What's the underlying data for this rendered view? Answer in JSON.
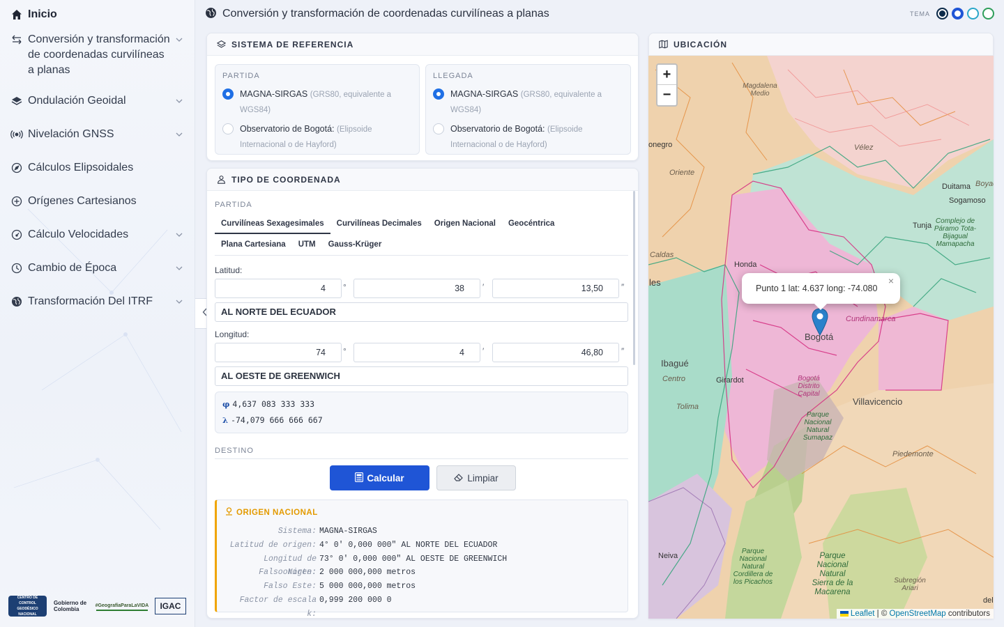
{
  "sidebar": {
    "items": [
      {
        "label": "Inicio",
        "icon": "home-icon"
      },
      {
        "label": "Conversión y transformación de coordenadas curvilíneas a planas",
        "icon": "arrows-exchange-icon"
      },
      {
        "label": "Ondulación Geoidal",
        "icon": "layers-icon"
      },
      {
        "label": "Nivelación GNSS",
        "icon": "broadcast-icon"
      },
      {
        "label": "Cálculos Elipsoidales",
        "icon": "compass-icon"
      },
      {
        "label": "Orígenes Cartesianos",
        "icon": "plus-circle-icon"
      },
      {
        "label": "Cálculo Velocidades",
        "icon": "speedometer-icon"
      },
      {
        "label": "Cambio de Época",
        "icon": "clock-icon"
      },
      {
        "label": "Transformación Del ITRF",
        "icon": "globe-icon"
      }
    ],
    "logos": {
      "logo1": "CENTRO DE CONTROL GEODÉSICO NACIONAL",
      "logo2": "Gobierno de Colombia",
      "logo3": "#GeografíaParaLaVIDA",
      "logo4": "IGAC"
    }
  },
  "header": {
    "title": "Conversión y transformación de coordenadas curvilíneas a planas",
    "theme_label": "TEMA",
    "theme_colors": [
      "#0d2b4a",
      "#1f55d6",
      "#2aa7c9",
      "#2e9e5a"
    ]
  },
  "reference": {
    "title": "SISTEMA DE REFERENCIA",
    "partida": {
      "caption": "PARTIDA",
      "opt1": "MAGNA-SIRGAS",
      "opt1_note": "(GRS80, equivalente a",
      "opt1_note2": "WGS84)",
      "opt2": "Observatorio de Bogotá:",
      "opt2_note": "(Elipsoide",
      "opt2_note2": "Internacional o de Hayford)"
    },
    "llegada": {
      "caption": "LLEGADA",
      "opt1": "MAGNA-SIRGAS",
      "opt1_note": "(GRS80, equivalente a",
      "opt1_note2": "WGS84)",
      "opt2": "Observatorio de Bogotá:",
      "opt2_note": "(Elipsoide",
      "opt2_note2": "Internacional o de Hayford)"
    }
  },
  "coords": {
    "title": "TIPO DE COORDENADA",
    "partida_caption": "PARTIDA",
    "tabs": [
      "Curvilíneas Sexagesimales",
      "Curvilíneas Decimales",
      "Origen Nacional",
      "Geocéntrica",
      "Plana Cartesiana",
      "UTM",
      "Gauss-Krüger"
    ],
    "latitude_label": "Latitud:",
    "lat_deg": "4",
    "lat_min": "38",
    "lat_sec": "13,50",
    "lat_hemisphere": "AL NORTE DEL ECUADOR",
    "longitude_label": "Longitud:",
    "lon_deg": "74",
    "lon_min": "4",
    "lon_sec": "46,80",
    "lon_hemisphere": "AL OESTE DE GREENWICH",
    "unit_deg": "°",
    "unit_min": "′",
    "unit_sec": "″",
    "phi_symbol": "φ",
    "phi_value": "4,637 083 333 333",
    "lambda_symbol": "λ",
    "lambda_value": "-74,079 666 666 667",
    "destino_caption": "DESTINO",
    "calc_label": "Calcular",
    "clear_label": "Limpiar"
  },
  "origin": {
    "title": "ORIGEN NACIONAL",
    "rows": [
      {
        "k": "Sistema:",
        "v": "MAGNA-SIRGAS"
      },
      {
        "k": "Latitud de origen:",
        "v": "4° 0' 0,000 000\" AL NORTE DEL ECUADOR"
      },
      {
        "k": "Longitud de origen:",
        "v": "73° 0' 0,000 000\" AL OESTE DE GREENWICH"
      },
      {
        "k": "Falso Norte:",
        "v": "2 000 000,000 metros"
      },
      {
        "k": "Falso Este:",
        "v": "5 000 000,000 metros"
      },
      {
        "k": "Factor de escala k:",
        "v": "0,999 200 000 0"
      }
    ]
  },
  "map": {
    "title": "UBICACIÓN",
    "zoom_in": "+",
    "zoom_out": "−",
    "popup": "Punto 1 lat: 4.637 long: -74.080",
    "popup_close": "×",
    "attribution_leaflet": "Leaflet",
    "attribution_sep": "| ©",
    "attribution_osm": "OpenStreetMap",
    "attribution_tail": "contributors",
    "labels": {
      "bogota": "Bogotá",
      "ibague": "Ibagué",
      "villavicencio": "Villavicencio",
      "honda": "Honda",
      "tunja": "Tunja",
      "duitama": "Duitama",
      "sogamoso": "Sogamoso",
      "cundinamarca": "Cundinamarca",
      "caldas": "Caldas",
      "neiva": "Neiva",
      "tolima": "Tolima",
      "girardot": "Girardot",
      "piedemonte": "Piedemonte",
      "velez": "Vélez",
      "oriente": "Oriente",
      "centro": "Centro",
      "magdalena_medio": "Magdalena Medio",
      "subregion_ariari": "Subregión Ariari",
      "bogota_dc": "Bogotá Distrito Capital",
      "pn_sumapaz": "Parque Nacional Natural Sumapaz",
      "pn_macarena": "Parque Nacional Natural Sierra de la Macarena",
      "pn_picachos": "Parque Nacional Natural Cordillera de los Picachos",
      "paramo": "Complejo de Páramo Tota-Bijagual Mamapacha",
      "edge_les": "les",
      "edge_onegro": "onegro",
      "edge_boyaca": "Boyac",
      "edge_del": "del"
    }
  }
}
